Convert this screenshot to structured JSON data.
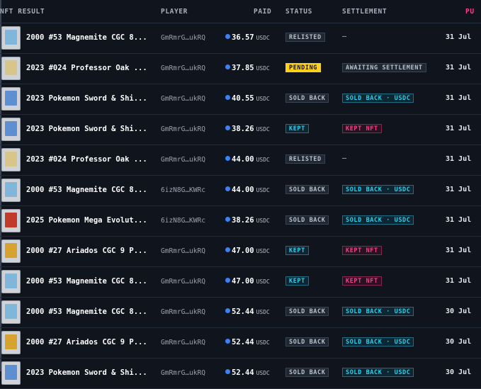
{
  "header": {
    "nft_result": "NFT RESULT",
    "player": "PLAYER",
    "paid": "PAID",
    "status": "STATUS",
    "settlement": "SETTLEMENT",
    "pu": "PU"
  },
  "rows": [
    {
      "name": "2000 #53 Magnemite CGC 8...",
      "player": "GmRmrG…ukRQ",
      "paid": "36.57",
      "currency": "USDC",
      "status": "RELISTED",
      "settlement": "—",
      "date": "31 Jul"
    },
    {
      "name": "2023 #024 Professor Oak ...",
      "player": "GmRmrG…ukRQ",
      "paid": "37.85",
      "currency": "USDC",
      "status": "PENDING",
      "settlement": "AWAITING SETTLEMENT",
      "date": "31 Jul"
    },
    {
      "name": "2023 Pokemon Sword & Shi...",
      "player": "GmRmrG…ukRQ",
      "paid": "40.55",
      "currency": "USDC",
      "status": "SOLD BACK",
      "settlement": "SOLD BACK · USDC",
      "date": "31 Jul"
    },
    {
      "name": "2023 Pokemon Sword & Shi...",
      "player": "GmRmrG…ukRQ",
      "paid": "38.26",
      "currency": "USDC",
      "status": "KEPT",
      "settlement": "KEPT NFT",
      "date": "31 Jul"
    },
    {
      "name": "2023 #024 Professor Oak ...",
      "player": "GmRmrG…ukRQ",
      "paid": "44.00",
      "currency": "USDC",
      "status": "RELISTED",
      "settlement": "—",
      "date": "31 Jul"
    },
    {
      "name": "2000 #53 Magnemite CGC 8...",
      "player": "6izN8G…KWRc",
      "paid": "44.00",
      "currency": "USDC",
      "status": "SOLD BACK",
      "settlement": "SOLD BACK · USDC",
      "date": "31 Jul"
    },
    {
      "name": "2025 Pokemon Mega Evolut...",
      "player": "6izN8G…KWRc",
      "paid": "38.26",
      "currency": "USDC",
      "status": "SOLD BACK",
      "settlement": "SOLD BACK · USDC",
      "date": "31 Jul"
    },
    {
      "name": "2000 #27 Ariados CGC 9 P...",
      "player": "GmRmrG…ukRQ",
      "paid": "47.00",
      "currency": "USDC",
      "status": "KEPT",
      "settlement": "KEPT NFT",
      "date": "31 Jul"
    },
    {
      "name": "2000 #53 Magnemite CGC 8...",
      "player": "GmRmrG…ukRQ",
      "paid": "47.00",
      "currency": "USDC",
      "status": "KEPT",
      "settlement": "KEPT NFT",
      "date": "31 Jul"
    },
    {
      "name": "2000 #53 Magnemite CGC 8...",
      "player": "GmRmrG…ukRQ",
      "paid": "52.44",
      "currency": "USDC",
      "status": "SOLD BACK",
      "settlement": "SOLD BACK · USDC",
      "date": "30 Jul"
    },
    {
      "name": "2000 #27 Ariados CGC 9 P...",
      "player": "GmRmrG…ukRQ",
      "paid": "52.44",
      "currency": "USDC",
      "status": "SOLD BACK",
      "settlement": "SOLD BACK · USDC",
      "date": "30 Jul"
    },
    {
      "name": "2023 Pokemon Sword & Shi...",
      "player": "GmRmrG…ukRQ",
      "paid": "52.44",
      "currency": "USDC",
      "status": "SOLD BACK",
      "settlement": "SOLD BACK · USDC",
      "date": "30 Jul"
    }
  ],
  "colors": {
    "accent_pink": "#ff3b8e",
    "accent_cyan": "#22d3ee",
    "pending_yellow": "#ffd21a",
    "coin_blue": "#3b82f6"
  },
  "icons": {
    "coin": "usdc-coin-icon",
    "thumb": "card-thumbnail-icon"
  }
}
